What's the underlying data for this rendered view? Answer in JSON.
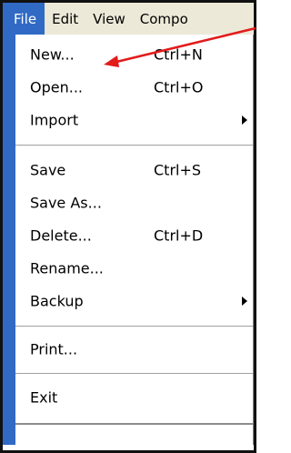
{
  "menubar": {
    "menus": [
      "File",
      "Edit",
      "View",
      "Compo"
    ]
  },
  "file_menu": {
    "items": [
      {
        "label": "New...",
        "shortcut": "Ctrl+N"
      },
      {
        "label": "Open...",
        "shortcut": "Ctrl+O"
      },
      {
        "label": "Import",
        "shortcut": ""
      },
      {
        "label": "Save",
        "shortcut": "Ctrl+S"
      },
      {
        "label": "Save As...",
        "shortcut": ""
      },
      {
        "label": "Delete...",
        "shortcut": "Ctrl+D"
      },
      {
        "label": "Rename...",
        "shortcut": ""
      },
      {
        "label": "Backup",
        "shortcut": ""
      },
      {
        "label": "Print...",
        "shortcut": ""
      },
      {
        "label": "Exit",
        "shortcut": ""
      }
    ]
  },
  "colors": {
    "menu_highlight": "#316ac5",
    "menubar_bg": "#ece9d8",
    "annotation_arrow": "#e31b1b"
  },
  "icons": {
    "submenu": "submenu-arrow-icon",
    "annotation": "red-pointer-arrow"
  }
}
